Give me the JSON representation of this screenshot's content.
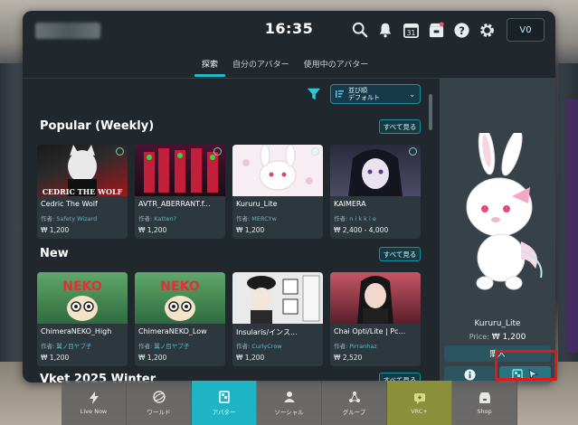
{
  "topbar": {
    "clock": "16:35",
    "wallet": "V0",
    "icons": [
      "search-icon",
      "notifications-icon",
      "calendar-icon",
      "store-icon",
      "help-icon",
      "settings-icon"
    ],
    "calendar_day": "31"
  },
  "tabs": [
    {
      "label": "探索",
      "active": true
    },
    {
      "label": "自分のアバター",
      "active": false
    },
    {
      "label": "使用中のアバター",
      "active": false
    }
  ],
  "sort": {
    "line1": "並び順",
    "line2": "デフォルト"
  },
  "sections": {
    "popular": {
      "title": "Popular (Weekly)",
      "see_all": "すべて見る"
    },
    "new": {
      "title": "New",
      "see_all": "すべて見る"
    },
    "vket": {
      "title": "Vket 2025 Winter",
      "see_all": "すべて見る"
    }
  },
  "author_prefix": "作者:",
  "popular_cards": [
    {
      "name": "Cedric The Wolf",
      "author": "Safety Wizard",
      "price": "₩ 1,200",
      "thumb_text": "CEDRIC THE WOLF",
      "bg": "#8a1e22"
    },
    {
      "name": "AVTR_ABERRANT.f...",
      "author": "Katten?",
      "price": "₩ 1,200",
      "thumb_text": "",
      "bg": "#6a1020"
    },
    {
      "name": "Kururu_Lite",
      "author": "MERCYw",
      "price": "₩ 1,200",
      "thumb_text": "",
      "bg": "#f4e9f0"
    },
    {
      "name": "KAIMERA",
      "author": "n i k k i e",
      "price": "₩ 2,400 - 4,000",
      "thumb_text": "",
      "bg": "#2a2a40"
    }
  ],
  "new_cards": [
    {
      "name": "ChimeraNEKO_High",
      "author": "翼ノ目ヤブ子",
      "price": "₩ 1,200",
      "thumb_text": "NEKO",
      "bg": "#3f7a4a"
    },
    {
      "name": "ChimeraNEKO_Low",
      "author": "翼ノ目ヤブ子",
      "price": "₩ 1,200",
      "thumb_text": "NEKO",
      "bg": "#3f7a4a"
    },
    {
      "name": "Insularis/インス...",
      "author": "CurlyCrow",
      "price": "₩ 1,200",
      "thumb_text": "",
      "bg": "#e9e9e9"
    },
    {
      "name": "Chai Opti/Lite | Pc...",
      "author": "Pirranhaz",
      "price": "₩ 2,520",
      "thumb_text": "",
      "bg": "#b34a56"
    }
  ],
  "preview": {
    "name": "Kururu_Lite",
    "price_label": "Price:",
    "price": "₩ 1,200",
    "buy_label": "購入"
  },
  "dock": [
    {
      "label": "Live Now",
      "icon": "lightning-icon",
      "active": false
    },
    {
      "label": "ワールド",
      "icon": "globe-icon",
      "active": false
    },
    {
      "label": "アバター",
      "icon": "avatar-icon",
      "active": true
    },
    {
      "label": "ソーシャル",
      "icon": "social-icon",
      "active": false
    },
    {
      "label": "グループ",
      "icon": "group-icon",
      "active": false
    },
    {
      "label": "VRC+",
      "icon": "vrc-plus-icon",
      "active": false
    },
    {
      "label": "Shop",
      "icon": "shop-icon",
      "active": false
    }
  ],
  "colors": {
    "accent": "#1fb9cc",
    "panel": "#20282e",
    "highlight": "#e01818"
  }
}
